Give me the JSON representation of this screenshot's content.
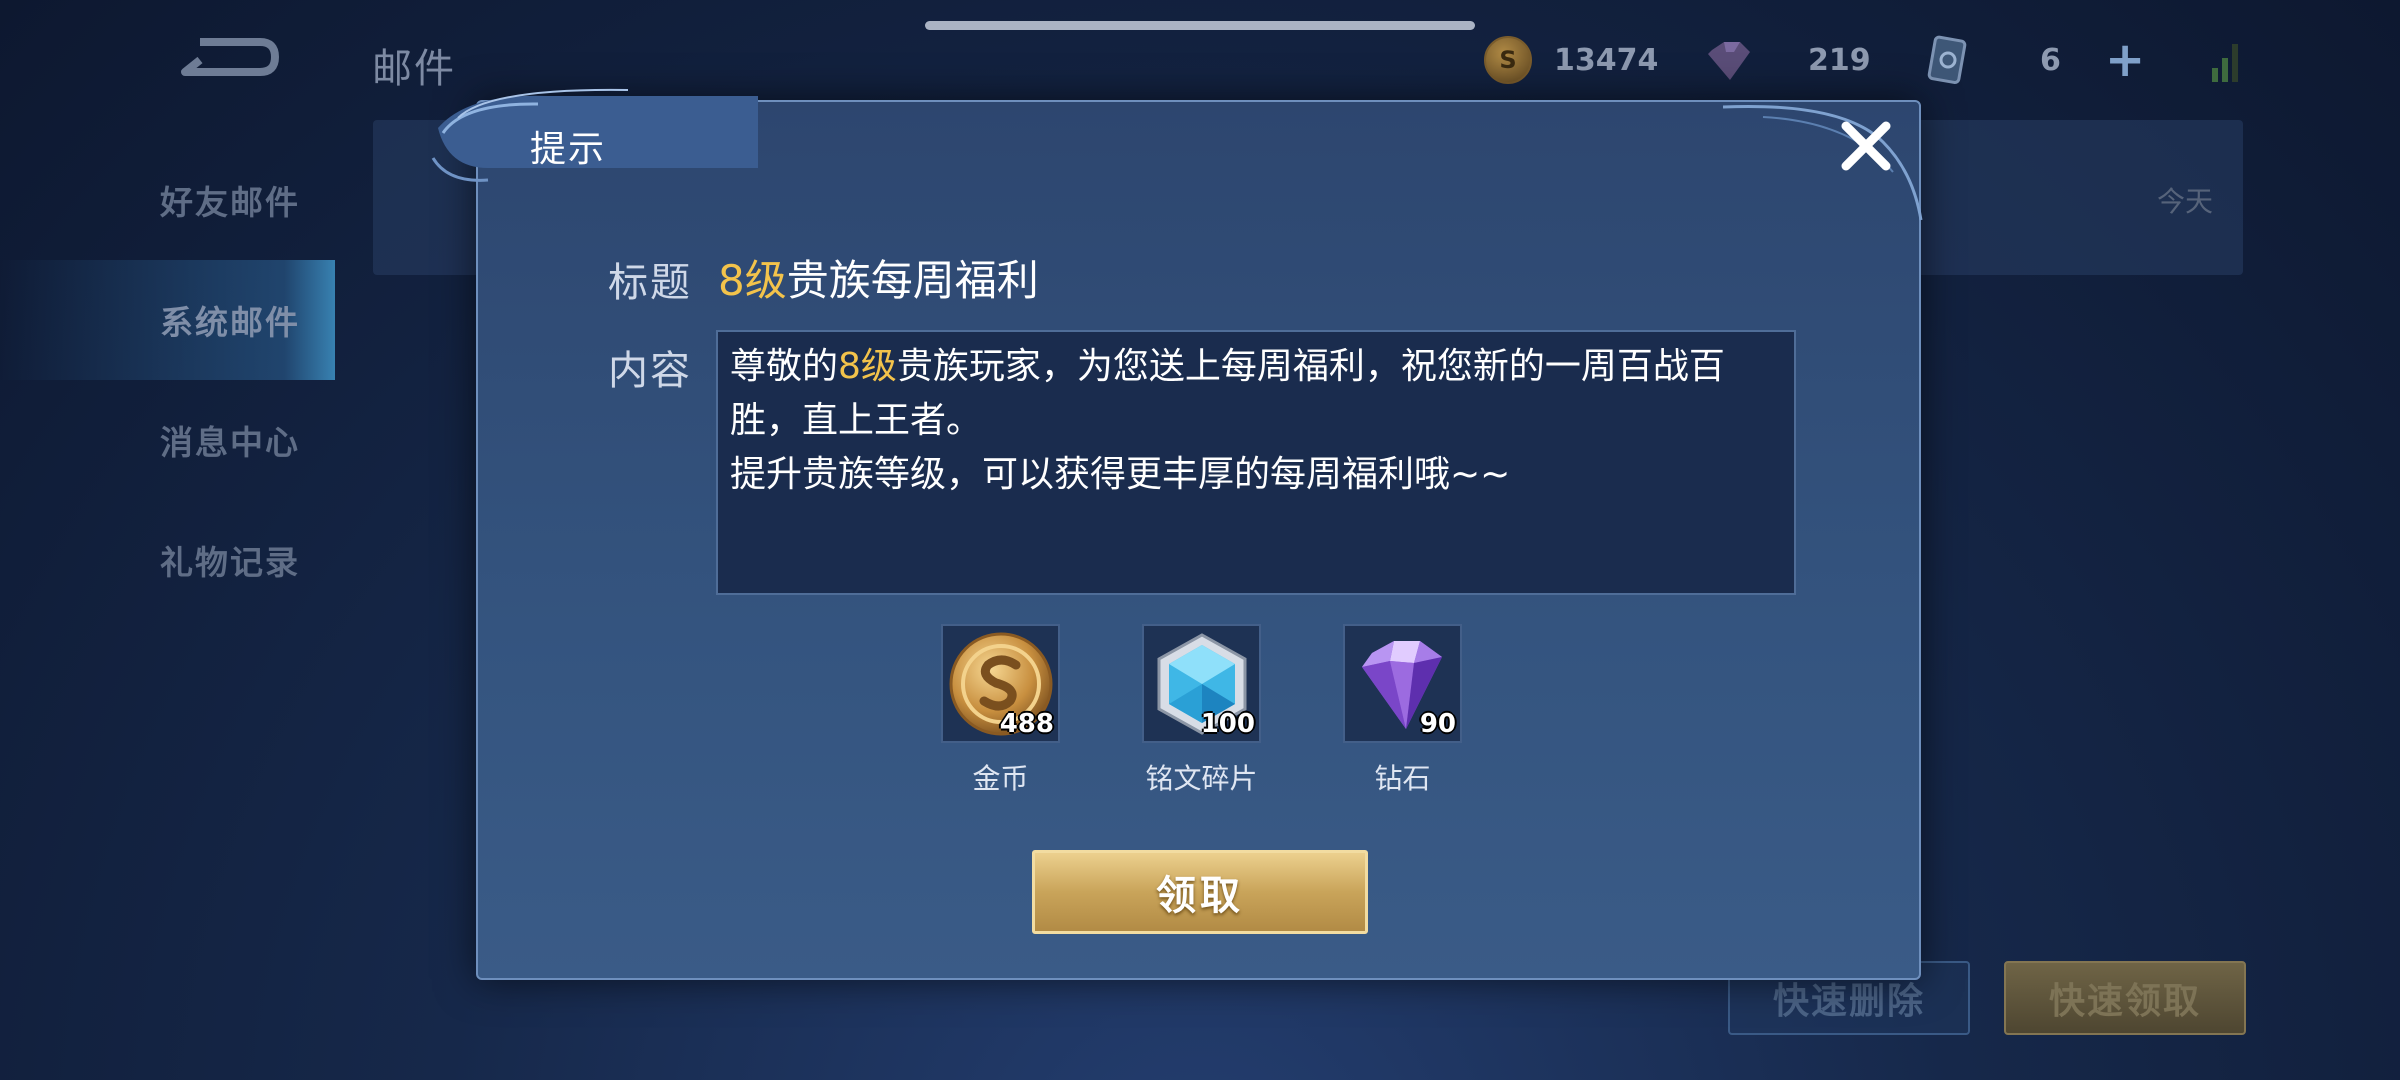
{
  "page": {
    "title": "邮件",
    "resources": {
      "coins": "13474",
      "diamonds": "219",
      "tickets": "6"
    },
    "sidebar": {
      "items": [
        {
          "label": "好友邮件"
        },
        {
          "label": "系统邮件"
        },
        {
          "label": "消息中心"
        },
        {
          "label": "礼物记录"
        }
      ]
    },
    "mail_row": {
      "date": "今天"
    },
    "buttons": {
      "quick_delete": "快速删除",
      "quick_claim": "快速领取"
    }
  },
  "dialog": {
    "title": "提示",
    "title_label": "标题",
    "mail_title_level": "8级",
    "mail_title_rest": "贵族每周福利",
    "content_label": "内容",
    "content": {
      "line1_pre": "尊敬的",
      "line1_level": "8级",
      "line1_post": "贵族玩家，为您送上每周福利，祝您新的一周百战百胜，直上王者。",
      "line2": "提升贵族等级，可以获得更丰厚的每周福利哦~~"
    },
    "rewards": [
      {
        "name": "金币",
        "qty": "488",
        "icon": "gold-coin-icon"
      },
      {
        "name": "铭文碎片",
        "qty": "100",
        "icon": "inscription-fragment-icon"
      },
      {
        "name": "钻石",
        "qty": "90",
        "icon": "diamond-icon"
      }
    ],
    "claim_label": "领取"
  },
  "colors": {
    "highlight": "#f3c34b",
    "claim_button": "#c9a45a",
    "dialog_bg": "#34547f"
  }
}
